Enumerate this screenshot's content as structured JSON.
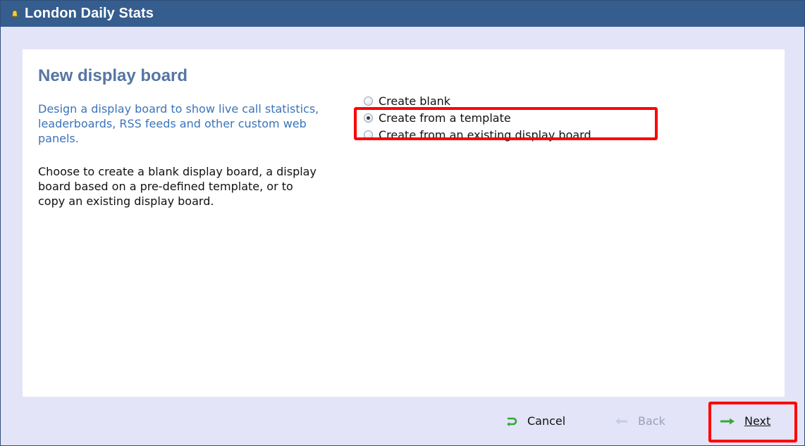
{
  "window": {
    "title": "London Daily Stats",
    "title_icon": "bell-icon"
  },
  "main": {
    "heading": "New display board",
    "description": "Design a display board to show live call statistics, leaderboards, RSS feeds and other custom web panels.",
    "instructions": "Choose to create a blank display board, a display board based on a pre-defined template, or to copy an existing display board.",
    "options": [
      {
        "label": "Create blank",
        "selected": false
      },
      {
        "label": "Create from a template",
        "selected": true
      },
      {
        "label": "Create from an existing display board",
        "selected": false
      }
    ]
  },
  "footer": {
    "cancel_label": "Cancel",
    "back_label": "Back",
    "next_label": "Next",
    "cancel_icon": "undo-arrow-icon",
    "back_icon": "arrow-left-icon",
    "next_icon": "arrow-right-icon"
  },
  "colors": {
    "titlebar": "#355d8e",
    "heading": "#5775a4",
    "description": "#3a74ba",
    "highlight": "#ff0000",
    "icon_green": "#3aa63a"
  }
}
